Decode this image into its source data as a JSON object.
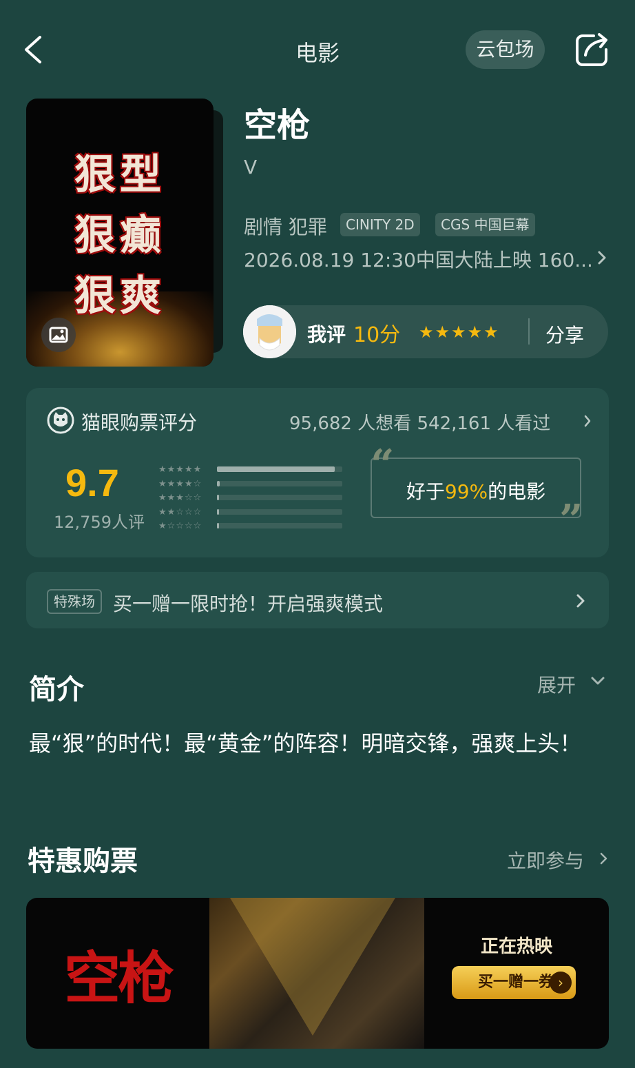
{
  "header": {
    "title": "电影",
    "pill_label": "云包场"
  },
  "poster": {
    "lines": [
      "狠型",
      "狠癫",
      "狠爽"
    ]
  },
  "movie": {
    "title": "空枪",
    "subtitle": "V",
    "genres": "剧情 犯罪",
    "tags": [
      "CINITY 2D",
      "CGS 中国巨幕"
    ],
    "release": "2026.08.19 12:30中国大陆上映 160..."
  },
  "my_rating": {
    "label": "我评",
    "score": "10分",
    "stars": "★★★★★",
    "share_label": "分享"
  },
  "rating_card": {
    "title": "猫眼购票评分",
    "counts": "95,682 人想看  542,161 人看过",
    "score": "9.7",
    "rating_count": "12,759人评",
    "distribution": [
      {
        "stars": "★★★★★",
        "fraction": 0.94
      },
      {
        "stars": "★★★★☆",
        "fraction": 0.02
      },
      {
        "stars": "★★★☆☆",
        "fraction": 0.015
      },
      {
        "stars": "★★☆☆☆",
        "fraction": 0.01
      },
      {
        "stars": "★☆☆☆☆",
        "fraction": 0.01
      }
    ],
    "compare_prefix": "好于",
    "compare_value": "99%",
    "compare_suffix": "的电影"
  },
  "promo": {
    "tag": "特殊场",
    "text": "买一赠一限时抢！开启强爽模式"
  },
  "intro": {
    "title": "简介",
    "expand_label": "展开",
    "text": "最“狠”的时代！最“黄金”的阵容！明暗交锋，强爽上头！"
  },
  "deals": {
    "title": "特惠购票",
    "join_label": "立即参与",
    "banner_logo": "空枪",
    "banner_hot": "正在热映",
    "banner_coupon": "买一赠一券"
  },
  "colors": {
    "background": "#1d4540",
    "accent": "#f5b90f",
    "card": "#25504a"
  }
}
